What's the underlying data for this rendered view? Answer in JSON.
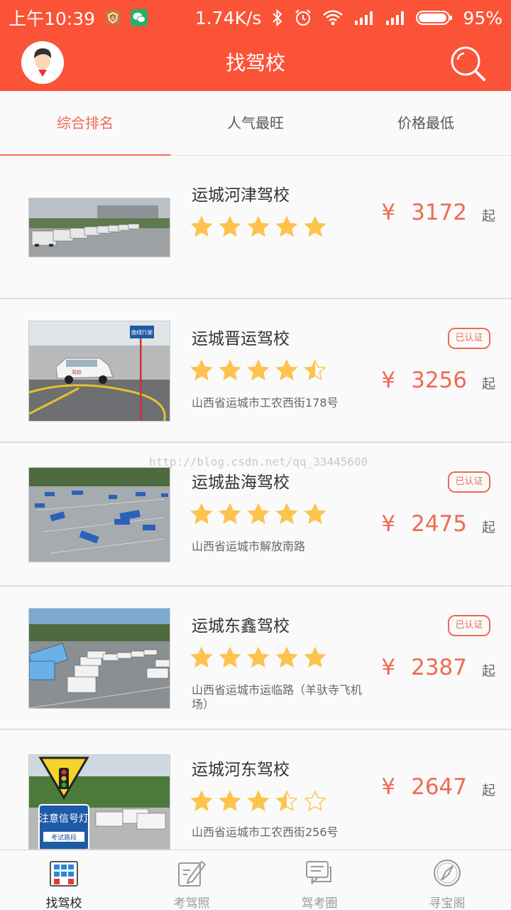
{
  "status_bar": {
    "time": "上午10:39",
    "net_speed": "1.74K/s",
    "battery": "95%"
  },
  "header": {
    "title": "找驾校"
  },
  "tabs": [
    {
      "label": "综合排名",
      "active": true
    },
    {
      "label": "人气最旺",
      "active": false
    },
    {
      "label": "价格最低",
      "active": false
    }
  ],
  "schools": [
    {
      "name": "运城河津驾校",
      "rating": 5,
      "address": "",
      "certified": false,
      "price": "3172"
    },
    {
      "name": "运城晋运驾校",
      "rating": 4.5,
      "address": "山西省运城市工农西街178号",
      "certified": true,
      "price": "3256"
    },
    {
      "name": "运城盐海驾校",
      "rating": 5,
      "address": "山西省运城市解放南路",
      "certified": true,
      "price": "2475"
    },
    {
      "name": "运城东鑫驾校",
      "rating": 5,
      "address": "山西省运城市运临路（羊驮寺飞机场）",
      "certified": true,
      "price": "2387"
    },
    {
      "name": "运城河东驾校",
      "rating": 3.5,
      "address": "山西省运城市工农西街256号",
      "certified": false,
      "price": "2647"
    }
  ],
  "labels": {
    "certified": "已认证",
    "currency": "¥",
    "from": "起",
    "thumb_sign": "曲线行驶",
    "road_sign_1": "注意信号灯",
    "road_sign_2": "考试路段"
  },
  "watermark": "http://blog.csdn.net/qq_33445600",
  "bottom_nav": [
    {
      "label": "找驾校",
      "icon": "building-icon",
      "active": true
    },
    {
      "label": "考驾照",
      "icon": "edit-icon",
      "active": false
    },
    {
      "label": "驾考圈",
      "icon": "chat-icon",
      "active": false
    },
    {
      "label": "寻宝阁",
      "icon": "compass-icon",
      "active": false
    }
  ],
  "colors": {
    "primary": "#fb5337",
    "accent": "#f06a52",
    "star": "#fdc34d"
  }
}
